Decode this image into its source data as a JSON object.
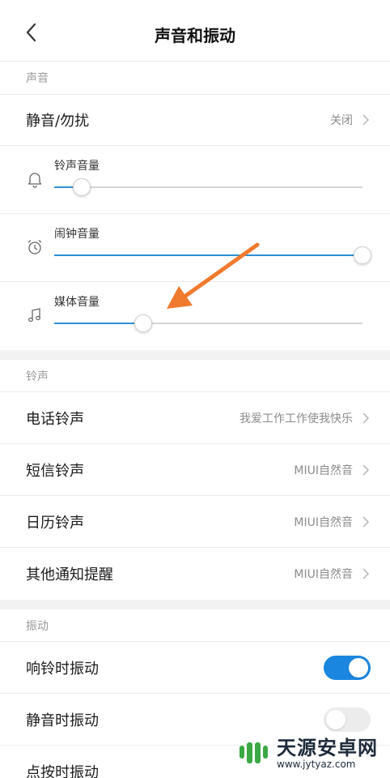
{
  "header": {
    "title": "声音和振动",
    "back_icon": "chevron-left-icon"
  },
  "sound": {
    "section_label": "声音",
    "dnd": {
      "label": "静音/勿扰",
      "value": "关闭"
    },
    "volumes": [
      {
        "label": "铃声音量",
        "icon": "bell-icon",
        "level": 0.09
      },
      {
        "label": "闹钟音量",
        "icon": "alarm-clock-icon",
        "level": 1.0
      },
      {
        "label": "媒体音量",
        "icon": "music-note-icon",
        "level": 0.29
      }
    ]
  },
  "ringtones": {
    "section_label": "铃声",
    "items": [
      {
        "label": "电话铃声",
        "value": "我爱工作工作使我快乐"
      },
      {
        "label": "短信铃声",
        "value": "MIUI自然音"
      },
      {
        "label": "日历铃声",
        "value": "MIUI自然音"
      },
      {
        "label": "其他通知提醒",
        "value": "MIUI自然音"
      }
    ]
  },
  "vibration": {
    "section_label": "振动",
    "items": [
      {
        "label": "响铃时振动",
        "on": true
      },
      {
        "label": "静音时振动",
        "on": false
      },
      {
        "label": "点按时振动"
      }
    ]
  },
  "colors": {
    "accent": "#1a86e0",
    "annotation_arrow": "#f07a2e"
  },
  "watermark": {
    "title": "天源安卓网",
    "url": "www.jytyaz.com"
  }
}
